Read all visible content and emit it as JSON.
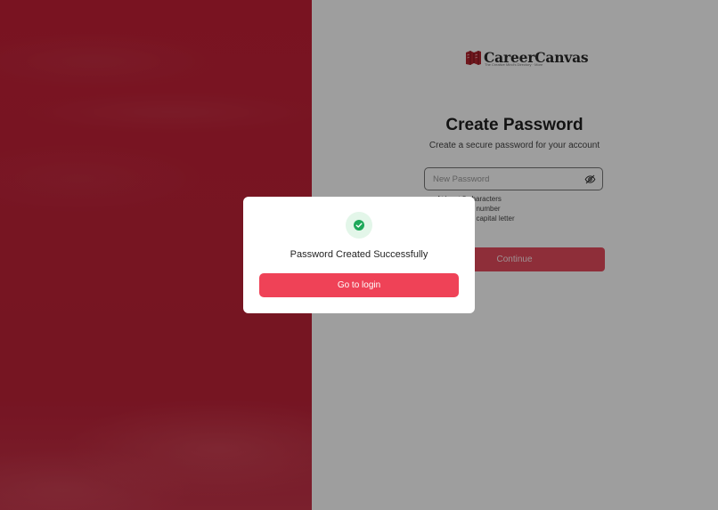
{
  "brand": {
    "name": "CareerCanvas",
    "tagline": "The Creative Mind's Directory · More"
  },
  "form": {
    "title": "Create Password",
    "subtitle": "Create a secure password for your account",
    "password_placeholder": "New Password",
    "password_value": "",
    "rules": [
      "At least 8 characters",
      "At least one number",
      "At least one capital letter"
    ],
    "continue_label": "Continue"
  },
  "modal": {
    "message": "Password Created Successfully",
    "button_label": "Go to login",
    "icon": "check-circle-icon"
  },
  "colors": {
    "brand_red": "#be2238",
    "primary_button": "#ef4257",
    "success_green": "#1ea85a"
  }
}
